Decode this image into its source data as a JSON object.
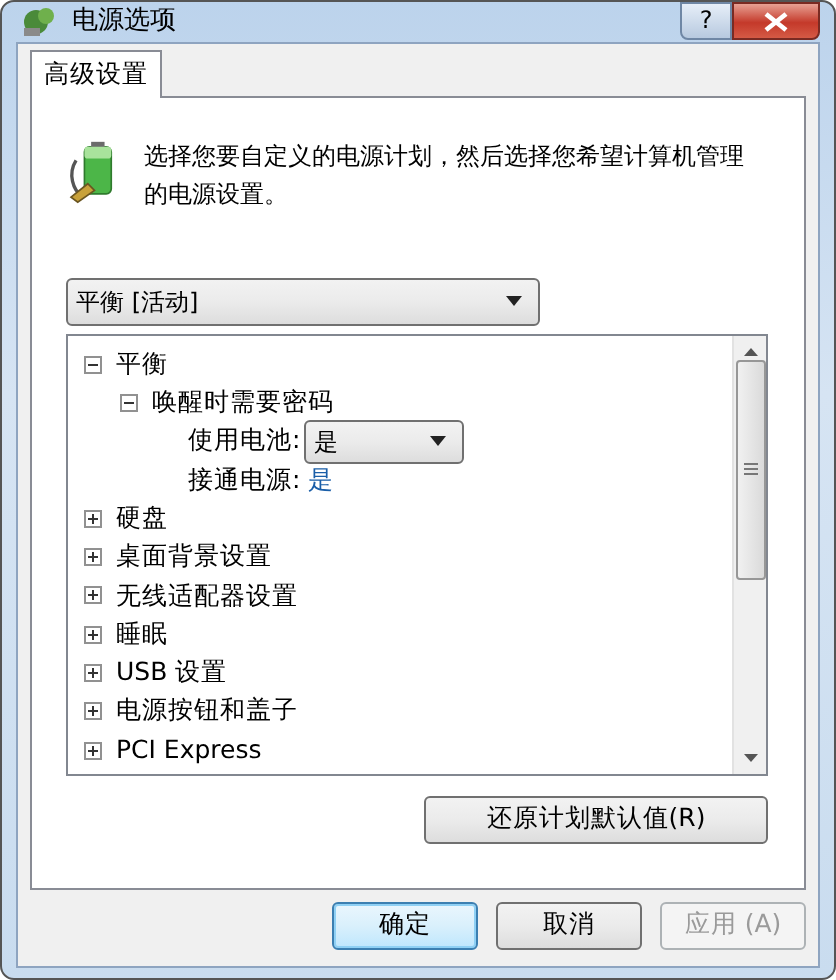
{
  "window": {
    "title": "电源选项",
    "help": "?"
  },
  "tabs": [
    {
      "label": "高级设置",
      "selected": true
    }
  ],
  "description": "选择您要自定义的电源计划，然后选择您希望计算机管理的电源设置。",
  "plan_select": {
    "value": "平衡 [活动]"
  },
  "tree": [
    {
      "label": "平衡",
      "expanded": true,
      "children": [
        {
          "label": "唤醒时需要密码",
          "expanded": true,
          "children": [
            {
              "kind": "dropdown",
              "label": "使用电池:",
              "value": "是"
            },
            {
              "kind": "value",
              "label": "接通电源:",
              "value": "是"
            }
          ]
        }
      ]
    },
    {
      "label": "硬盘",
      "expanded": false
    },
    {
      "label": "桌面背景设置",
      "expanded": false
    },
    {
      "label": "无线适配器设置",
      "expanded": false
    },
    {
      "label": "睡眠",
      "expanded": false
    },
    {
      "label": "USB 设置",
      "expanded": false
    },
    {
      "label": "电源按钮和盖子",
      "expanded": false
    },
    {
      "label": "PCI Express",
      "expanded": false
    }
  ],
  "restore_button": "还原计划默认值(R)",
  "buttons": [
    {
      "label": "确定",
      "default": true,
      "disabled": false
    },
    {
      "label": "取消",
      "default": false,
      "disabled": false
    },
    {
      "label": "应用 (A)",
      "default": false,
      "disabled": true
    }
  ]
}
